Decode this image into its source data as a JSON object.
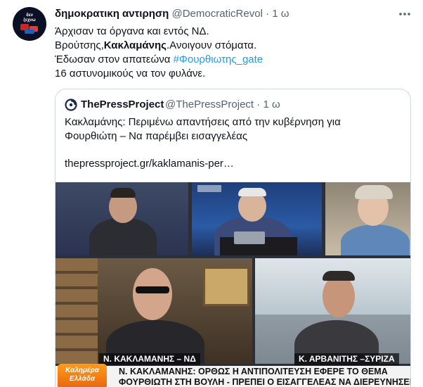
{
  "tweet": {
    "display_name": "δημοκρατικη αντιρηση",
    "handle": "@DemocraticRevol",
    "separator": "·",
    "time": "1 ω",
    "avatar_text": "δεν\nξεχνω",
    "lines": {
      "l1": "Άρχισαν τα όργανα και εντός ΝΔ.",
      "l2_pre": "Βρούτσης,",
      "l2_bold": "Κακλαμάνης",
      "l2_post": ".Ανοιγουν στόματα.",
      "l3_pre": "Έδωσαν στον απατεώνα ",
      "l3_hashtag": "#Φουρθιωτης_gate",
      "l4": "16 αστυνομικούς να τον φυλάνε."
    }
  },
  "quote": {
    "name": "ThePressProject",
    "handle": "@ThePressProject",
    "separator": "·",
    "time": "1 ω",
    "text_line1": "Κακλαμάνης: Περιμένω απαντήσεις από την κυβέρνηση για",
    "text_line2": "Φουρθιώτη – Να παρέμβει εισαγγελέας",
    "link": "thepressproject.gr/kaklamanis-per…"
  },
  "media": {
    "nameplate_left": "Ν. ΚΑΚΛΑΜΑΝΗΣ – ΝΔ",
    "nameplate_right": "Κ. ΑΡΒΑΝΙΤΗΣ –ΣΥΡΙΖΑ",
    "brand_line1": "Καλημέρα",
    "brand_line2": "Ελλάδα",
    "ticker_line1": "Ν. ΚΑΚΛΑΜΑΝΗΣ: ΟΡΘΩΣ Η ΑΝΤΙΠΟΛΙΤΕΥΣΗ ΕΦΕΡΕ ΤΟ ΘΕΜΑ",
    "ticker_line2": "ΦΟΥΡΘΙΩΤΗ ΣΤΗ ΒΟΥΛΗ - ΠΡΕΠΕΙ Ο ΕΙΣΑΓΓΕΛΕΑΣ ΝΑ ΔΙΕΡΕΥΝΗΣΕΙ ΤΟ ΘΕΜΑ"
  },
  "icons": {
    "more": "more-horizontal-icon",
    "quote_avatar": "thepressproject-logo-icon"
  },
  "colors": {
    "link": "#1d9bf0",
    "secondary_text": "#536471",
    "border": "#cfd9de",
    "brand_orange": "#e8650c"
  }
}
